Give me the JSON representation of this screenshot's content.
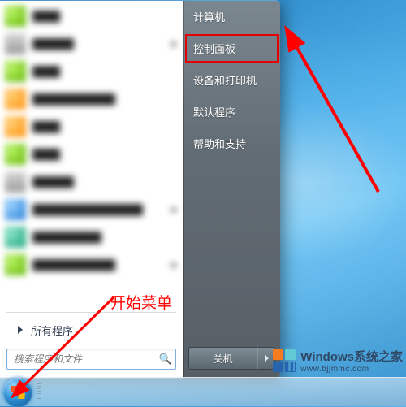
{
  "annotations": {
    "start_menu_label": "开始菜单"
  },
  "start_menu": {
    "right_items": {
      "computer": "计算机",
      "control_panel": "控制面板",
      "devices_printers": "设备和打印机",
      "default_programs": "默认程序",
      "help_support": "帮助和支持"
    },
    "all_programs_label": "所有程序",
    "search_placeholder": "搜索程序和文件",
    "shutdown_label": "关机"
  },
  "watermark": {
    "line1": "Windows系统之家",
    "line2": "www.bjjmmc.com"
  },
  "colors": {
    "highlight": "#e40000",
    "annotation": "#ff0000"
  }
}
